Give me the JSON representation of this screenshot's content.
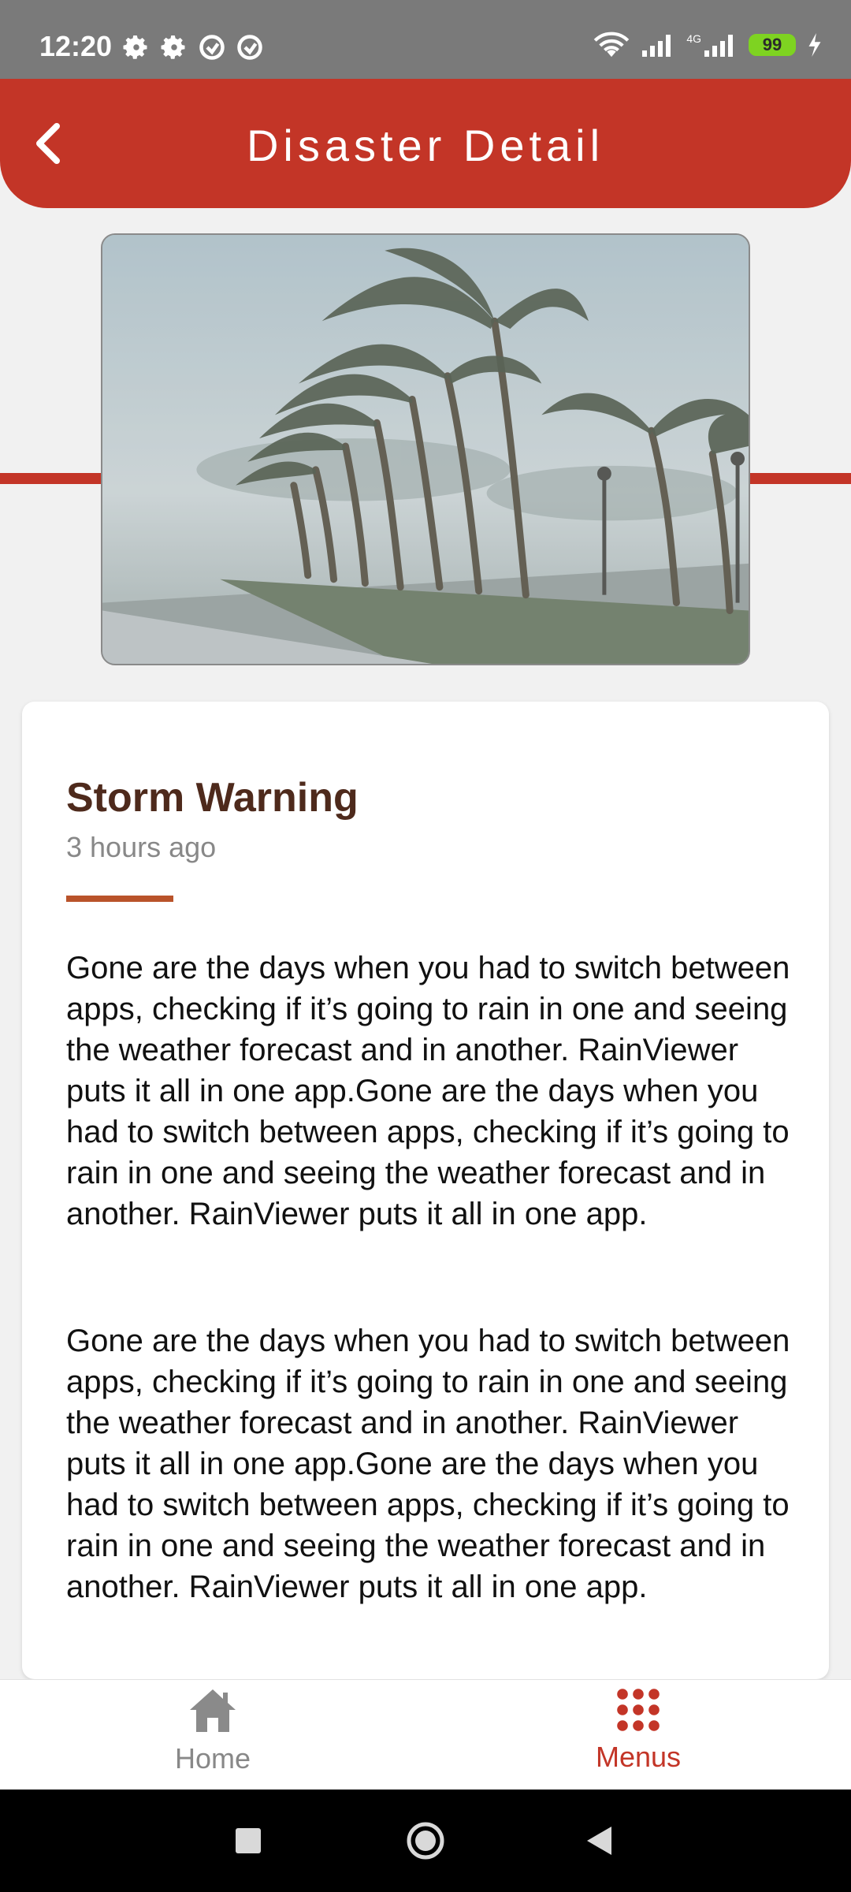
{
  "status_bar": {
    "time": "12:20",
    "battery": "99",
    "network": "4G",
    "icons": [
      "gear-icon",
      "gear-icon",
      "alarm-icon",
      "alarm-icon",
      "wifi-icon",
      "signal-icon",
      "signal-icon",
      "charging-icon"
    ]
  },
  "header": {
    "title": "Disaster Detail",
    "back_icon": "chevron-left-icon",
    "color": "#c33527"
  },
  "hero": {
    "image_subject": "palm trees bending in storm wind"
  },
  "article": {
    "title": "Storm Warning",
    "time_ago": "3 hours ago",
    "paragraphs": [
      "Gone are the days when you had to switch between apps, checking if it’s going to rain in one and seeing the weather forecast and in another. RainViewer puts it all in one app.Gone are the days when you had to switch between apps, checking if it’s going to rain in one and seeing the weather forecast and in another. RainViewer puts it all in one app.",
      "Gone are the days when you had to switch between apps, checking if it’s going to rain in one and seeing the weather forecast and in another. RainViewer puts it all in one app.Gone are the days when you had to switch between apps, checking if it’s going to rain in one and seeing the weather forecast and in another. RainViewer puts it all in one app."
    ],
    "title_color": "#4e2a1c",
    "accent_color": "#b9532a"
  },
  "bottom_nav": {
    "items": [
      {
        "label": "Home",
        "icon": "home-icon",
        "active": false
      },
      {
        "label": "Menus",
        "icon": "grid-dots-icon",
        "active": true
      }
    ],
    "active_color": "#c33527",
    "inactive_color": "#888888"
  },
  "system_nav": {
    "buttons": [
      "square-icon",
      "circle-icon",
      "back-triangle-icon"
    ]
  }
}
